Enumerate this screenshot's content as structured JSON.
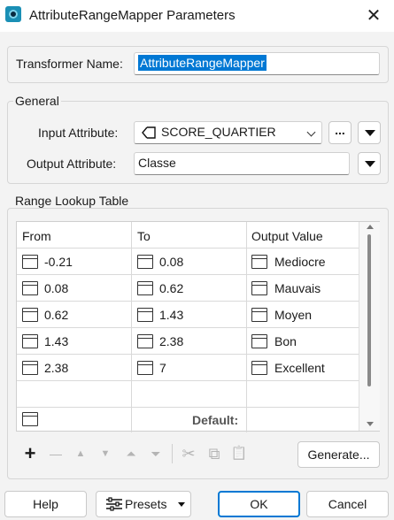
{
  "window": {
    "title": "AttributeRangeMapper Parameters",
    "close_glyph": "✕",
    "app_icon": "fme-transformer-icon"
  },
  "transformer": {
    "label": "Transformer Name:",
    "value": "AttributeRangeMapper"
  },
  "general": {
    "group_label": "General",
    "input_label": "Input Attribute:",
    "input_value": "SCORE_QUARTIER",
    "input_attr_icon": "attribute-tag-icon",
    "ellipsis_label": "...",
    "output_label": "Output Attribute:",
    "output_value": "Classe"
  },
  "range_table": {
    "group_label": "Range Lookup Table",
    "headers": [
      "From",
      "To",
      "Output Value"
    ],
    "rows": [
      [
        "-0.21",
        "0.08",
        "Mediocre"
      ],
      [
        "0.08",
        "0.62",
        "Mauvais"
      ],
      [
        "0.62",
        "1.43",
        "Moyen"
      ],
      [
        "1.43",
        "2.38",
        "Bon"
      ],
      [
        "2.38",
        "7",
        "Excellent"
      ]
    ],
    "default_label": "Default:"
  },
  "toolbar": {
    "add": "+",
    "remove": "—",
    "move_up": "▲",
    "move_down": "▼",
    "move_top": "⏶",
    "move_bottom": "⏷",
    "cut": "✂",
    "copy": "⧉",
    "paste": "📋",
    "generate_label": "Generate..."
  },
  "footer": {
    "help": "Help",
    "presets": "Presets",
    "presets_icon": "sliders-icon",
    "ok": "OK",
    "cancel": "Cancel"
  },
  "colors": {
    "accent": "#0078d4",
    "background": "#f3f3f3"
  }
}
